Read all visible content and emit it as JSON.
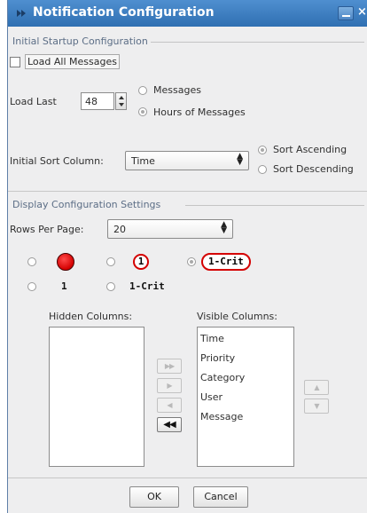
{
  "window": {
    "title": "Notification Configuration",
    "close_glyph": "×",
    "minimize_glyph": "–"
  },
  "startup": {
    "legend": "Initial Startup Configuration",
    "load_all_label": "Load All Messages",
    "load_last_label": "Load Last",
    "load_last_value": "48",
    "unit_options": [
      "Messages",
      "Hours of Messages"
    ],
    "unit_selected": "Hours of Messages",
    "sort_column_label": "Initial Sort Column:",
    "sort_column_value": "Time",
    "sort_order_options": [
      "Sort Ascending",
      "Sort Descending"
    ],
    "sort_order_selected": "Sort Ascending"
  },
  "display": {
    "legend": "Display Configuration Settings",
    "rows_per_page_label": "Rows Per Page:",
    "rows_per_page_value": "20",
    "priority_styles": [
      "red-dot",
      "1-ring",
      "1-Crit-pill",
      "1",
      "1-Crit"
    ],
    "priority_style_selected": "1-Crit-pill",
    "ring_text": "1",
    "pill_text": "1-Crit",
    "plain_one_text": "1",
    "plain_crit_text": "1-Crit",
    "hidden_columns_label": "Hidden Columns:",
    "visible_columns_label": "Visible Columns:",
    "hidden_columns": [],
    "visible_columns": [
      "Time",
      "Priority",
      "Category",
      "User",
      "Message"
    ],
    "move_buttons": [
      "▶▶",
      "▶",
      "◀",
      "◀◀"
    ],
    "order_buttons": [
      "▲",
      "▼"
    ]
  },
  "footer": {
    "ok_label": "OK",
    "cancel_label": "Cancel"
  },
  "colors": {
    "titlebar": "#3a7bc0",
    "accent_red": "#d40000"
  }
}
